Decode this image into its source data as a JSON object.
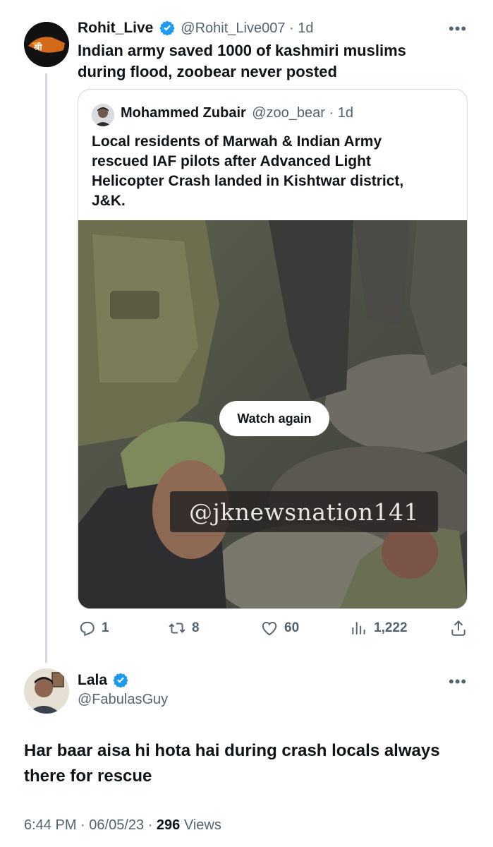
{
  "tweet": {
    "author_name": "Rohit_Live",
    "author_handle": "@Rohit_Live007",
    "separator": " · ",
    "age": "1d",
    "text_line1": "Indian army saved 1000 of kashmiri muslims",
    "text_line2": "during flood, zoobear never posted",
    "more_icon": "ellipsis-icon",
    "quoted": {
      "author_name": "Mohammed Zubair",
      "author_handle": "@zoo_bear",
      "separator": " · ",
      "age": "1d",
      "text_lines": [
        "Local residents of Marwah & Indian Army",
        "rescued IAF pilots after Advanced Light",
        "Helicopter Crash landed in Kishtwar district,",
        "J&K."
      ],
      "video": {
        "watch_again_label": "Watch again",
        "watermark": "@jknewsnation141"
      }
    },
    "stats": {
      "replies": "1",
      "retweets": "8",
      "likes": "60",
      "views": "1,222"
    }
  },
  "reply": {
    "author_name": "Lala",
    "author_handle": "@FabulasGuy",
    "text_line1": "Har baar aisa hi hota hai during crash locals always",
    "text_line2": "there for rescue",
    "time": "6:44 PM",
    "separator1": " · ",
    "date": "06/05/23",
    "separator2": " · ",
    "views_count": "296",
    "views_label": " Views"
  },
  "colors": {
    "verified": "#1d9bf0",
    "secondary_text": "#536471",
    "thread_line": "#cfd9de",
    "border": "#cfd9de"
  }
}
